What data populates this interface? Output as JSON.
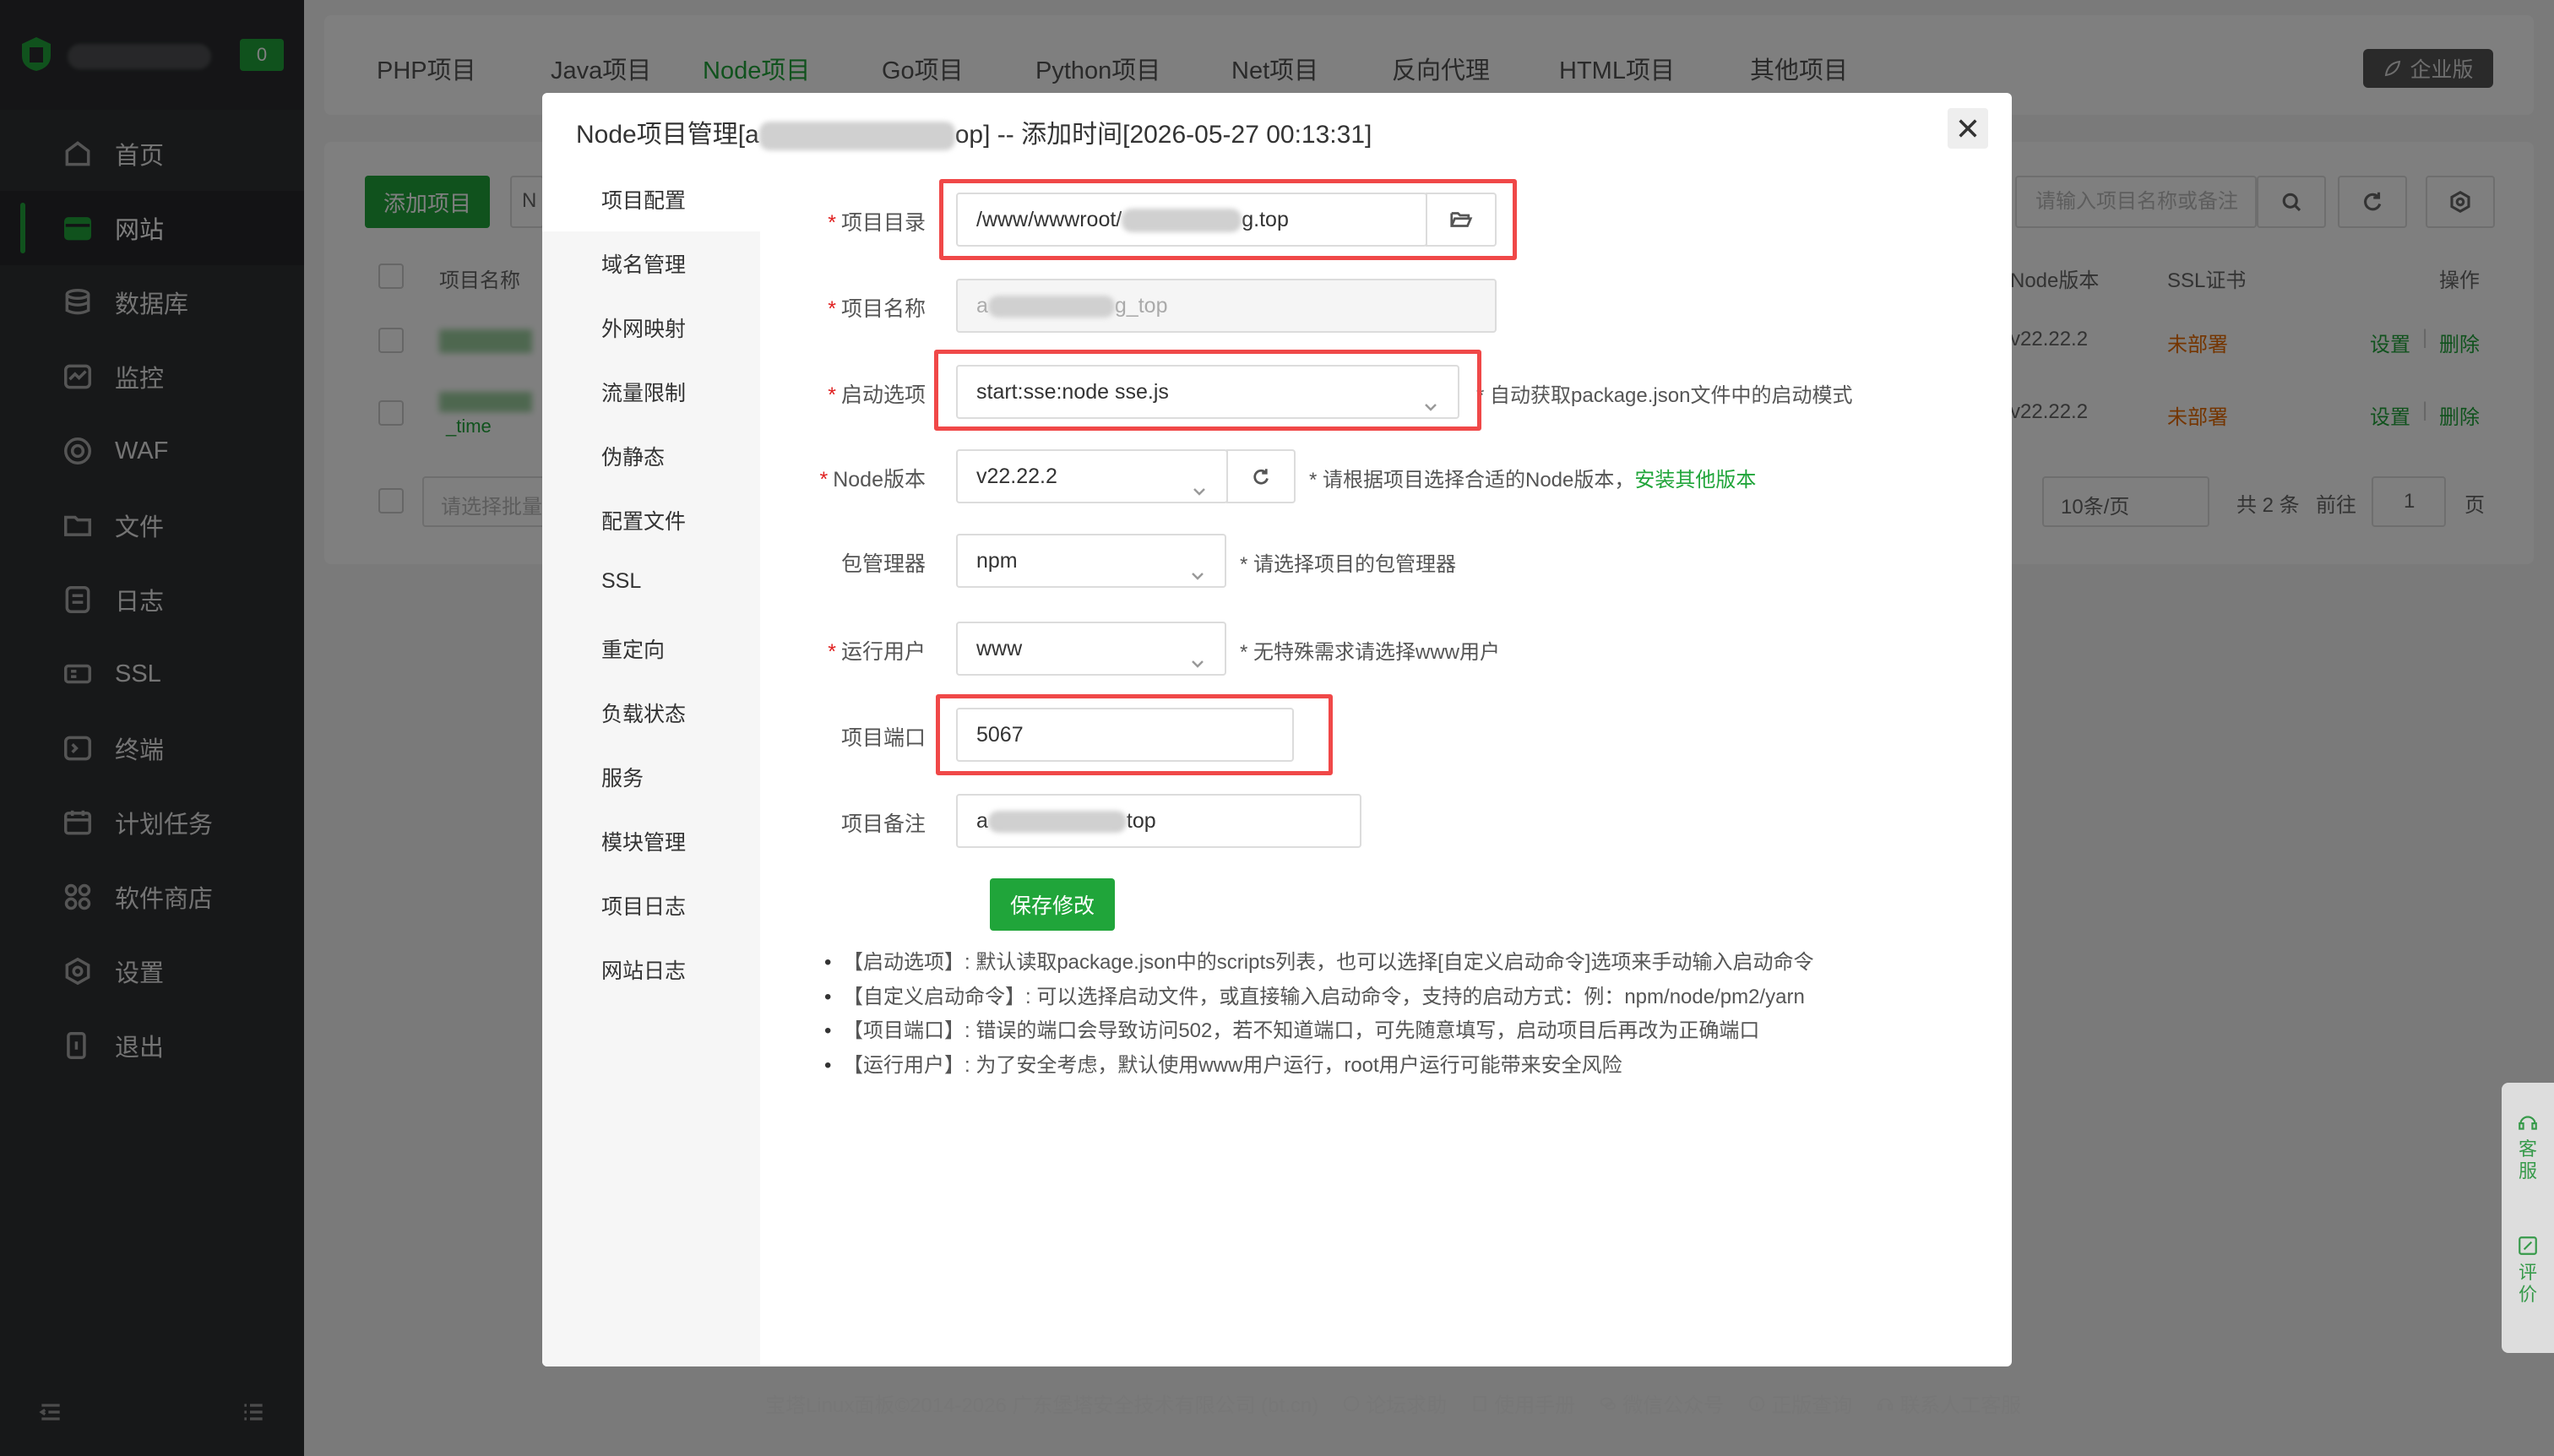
{
  "sidebar": {
    "badge": "0",
    "items": [
      {
        "label": "首页",
        "icon": "home-icon"
      },
      {
        "label": "网站",
        "icon": "website-icon",
        "active": true
      },
      {
        "label": "数据库",
        "icon": "database-icon"
      },
      {
        "label": "监控",
        "icon": "monitor-icon"
      },
      {
        "label": "WAF",
        "icon": "shield-icon"
      },
      {
        "label": "文件",
        "icon": "folder-icon"
      },
      {
        "label": "日志",
        "icon": "log-icon"
      },
      {
        "label": "SSL",
        "icon": "ssl-icon"
      },
      {
        "label": "终端",
        "icon": "terminal-icon"
      },
      {
        "label": "计划任务",
        "icon": "calendar-icon"
      },
      {
        "label": "软件商店",
        "icon": "apps-icon"
      },
      {
        "label": "设置",
        "icon": "settings-icon"
      },
      {
        "label": "退出",
        "icon": "logout-icon"
      }
    ]
  },
  "tabs": [
    "PHP项目",
    "Java项目",
    "Node项目",
    "Go项目",
    "Python项目",
    "Net项目",
    "反向代理",
    "HTML项目",
    "其他项目"
  ],
  "active_tab": "Node项目",
  "enterprise_label": "企业版",
  "background": {
    "add_button": "添加项目",
    "add_button_next": "N",
    "search_placeholder": "请输入项目名称或备注",
    "col_name": "项目名称",
    "col_node": "Node版本",
    "col_ssl": "SSL证书",
    "col_ops": "操作",
    "rows": [
      {
        "node": "v22.22.2",
        "ssl": "未部署",
        "set": "设置",
        "del": "删除",
        "name_suffix": ""
      },
      {
        "node": "v22.22.2",
        "ssl": "未部署",
        "set": "设置",
        "del": "删除",
        "name_suffix": "_time"
      }
    ],
    "batch_placeholder": "请选择批量",
    "page_size": "10条/页",
    "total": "共 2 条",
    "goto": "前往",
    "page": "1",
    "page_suffix": "页",
    "ops_separator": "|"
  },
  "modal": {
    "title_prefix": "Node项目管理[a",
    "title_suffix": "op] -- 添加时间[2026-05-27 00:13:31]",
    "menu": [
      "项目配置",
      "域名管理",
      "外网映射",
      "流量限制",
      "伪静态",
      "配置文件",
      "SSL",
      "重定向",
      "负载状态",
      "服务",
      "模块管理",
      "项目日志",
      "网站日志"
    ],
    "form": {
      "dir_label": "项目目录",
      "dir_value_prefix": "/www/wwwroot/",
      "dir_value_suffix": "g.top",
      "name_label": "项目名称",
      "name_value_prefix": "a",
      "name_value_suffix": "g_top",
      "start_label": "启动选项",
      "start_value": "start:sse:node sse.js",
      "start_hint": "自动获取package.json文件中的启动模式",
      "node_label": "Node版本",
      "node_value": "v22.22.2",
      "node_hint": "* 请根据项目选择合适的Node版本，",
      "node_hint_link": "安装其他版本",
      "pm_label": "包管理器",
      "pm_value": "npm",
      "pm_hint": "* 请选择项目的包管理器",
      "user_label": "运行用户",
      "user_value": "www",
      "user_hint": "* 无特殊需求请选择www用户",
      "port_label": "项目端口",
      "port_value": "5067",
      "note_label": "项目备注",
      "note_value_prefix": "a",
      "note_value_suffix": "top",
      "save_label": "保存修改",
      "required_mark": "*"
    },
    "notes": [
      "【启动选项】: 默认读取package.json中的scripts列表，也可以选择[自定义启动命令]选项来手动输入启动命令",
      "【自定义启动命令】: 可以选择启动文件，或直接输入启动命令，支持的启动方式：例：npm/node/pm2/yarn",
      "【项目端口】: 错误的端口会导致访问502，若不知道端口，可先随意填写，启动项目后再改为正确端口",
      "【运行用户】: 为了安全考虑，默认使用www用户运行，root用户运行可能带来安全风险"
    ]
  },
  "footer": {
    "copyright": "宝塔Linux面板©2014-2026 广东堡塔安全技术有限公司 (bt.cn)",
    "forum": "论坛求助",
    "manual": "使用手册",
    "wechat": "微信公众号",
    "verify": "正版查询",
    "support": "联系人工客服"
  },
  "float": {
    "service": "客服",
    "review": "评价"
  },
  "colors": {
    "accent": "#20a53a",
    "highlight_box": "#f04848",
    "warning": "#e96b00",
    "sidebar_bg": "#2f3033"
  }
}
